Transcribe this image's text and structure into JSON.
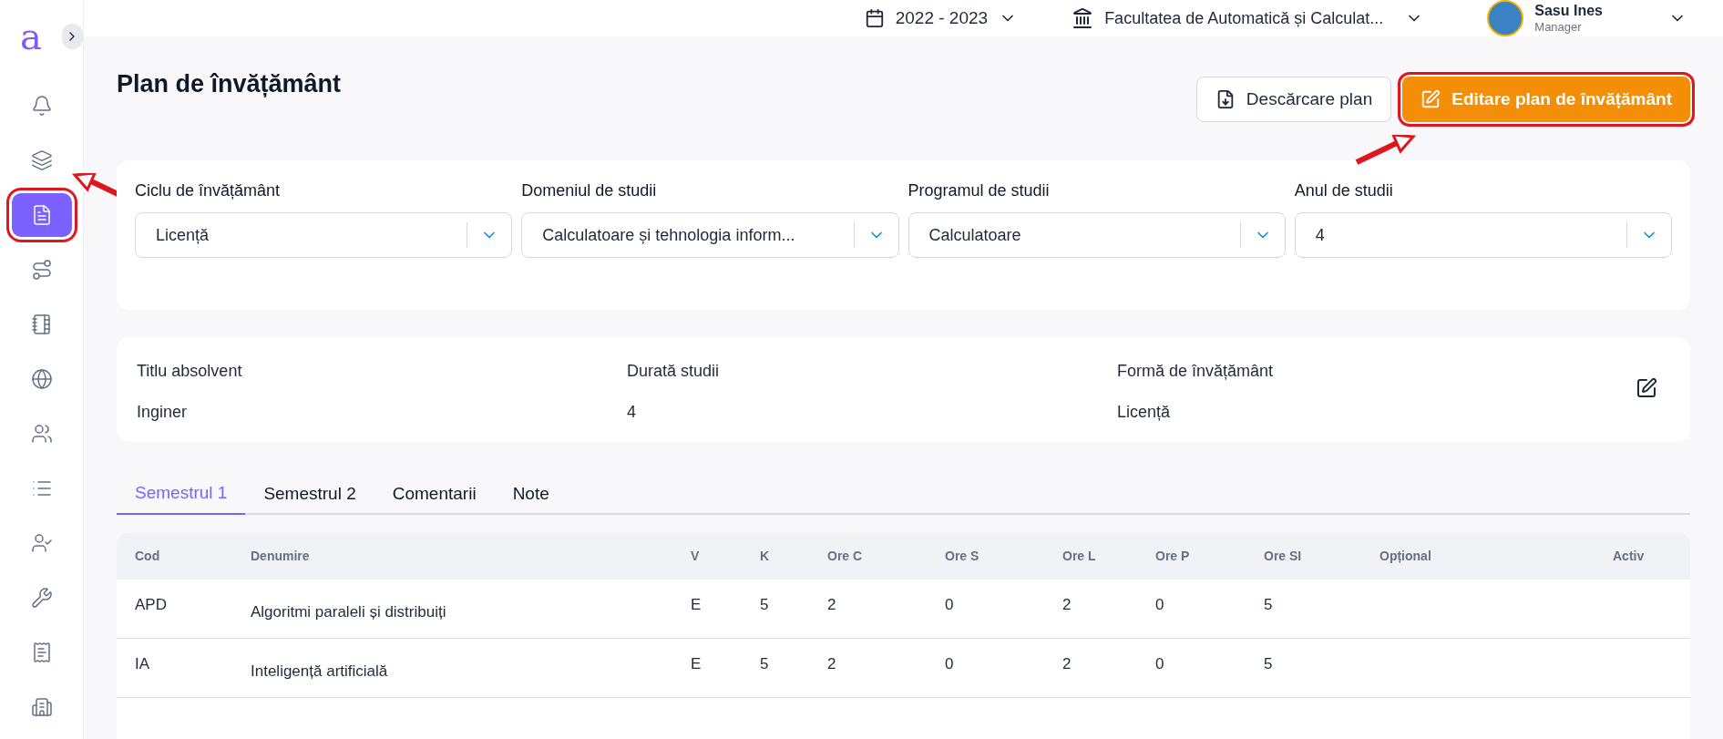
{
  "logo": "a",
  "sidebar": {
    "items": [
      {
        "selected": false,
        "annotated": false
      },
      {
        "selected": false,
        "annotated": false
      },
      {
        "selected": true,
        "annotated": true
      },
      {
        "selected": false,
        "annotated": false
      },
      {
        "selected": false,
        "annotated": false
      },
      {
        "selected": false,
        "annotated": false
      },
      {
        "selected": false,
        "annotated": false
      },
      {
        "selected": false,
        "annotated": false
      },
      {
        "selected": false,
        "annotated": false
      },
      {
        "selected": false,
        "annotated": false
      },
      {
        "selected": false,
        "annotated": false
      },
      {
        "selected": false,
        "annotated": false
      }
    ]
  },
  "topbar": {
    "year": "2022 - 2023",
    "faculty": "Facultatea de Automatică și Calculat...",
    "user": {
      "name": "Sasu Ines",
      "role": "Manager"
    }
  },
  "page": {
    "title": "Plan de învățământ",
    "buttons": [
      {
        "label": "Descărcare plan",
        "kind": "secondary",
        "annotated": false
      },
      {
        "label": "Editare plan de învățământ",
        "kind": "primary",
        "annotated": true
      }
    ]
  },
  "filters": [
    {
      "label": "Ciclu de învățământ",
      "value": "Licență"
    },
    {
      "label": "Domeniul de studii",
      "value": "Calculatoare și tehnologia inform..."
    },
    {
      "label": "Programul de studii",
      "value": "Calculatoare"
    },
    {
      "label": "Anul de studii",
      "value": "4"
    }
  ],
  "info": [
    {
      "label": "Titlu absolvent",
      "value": "Inginer"
    },
    {
      "label": "Durată studii",
      "value": "4"
    },
    {
      "label": "Formă de învățământ",
      "value": "Licență"
    }
  ],
  "tabs": [
    {
      "label": "Semestrul 1",
      "selected": true
    },
    {
      "label": "Semestrul 2",
      "selected": false
    },
    {
      "label": "Comentarii",
      "selected": false
    },
    {
      "label": "Note",
      "selected": false
    }
  ],
  "table": {
    "columns": [
      "Cod",
      "Denumire",
      "V",
      "K",
      "Ore C",
      "Ore S",
      "Ore L",
      "Ore P",
      "Ore SI",
      "Opțional",
      "Activ"
    ],
    "rows": [
      [
        "APD",
        "Algoritmi paraleli și distribuiți",
        "E",
        "5",
        "2",
        "0",
        "2",
        "0",
        "5"
      ],
      [
        "IA",
        "Inteligență artificială",
        "E",
        "5",
        "2",
        "0",
        "2",
        "0",
        "5"
      ],
      []
    ]
  }
}
